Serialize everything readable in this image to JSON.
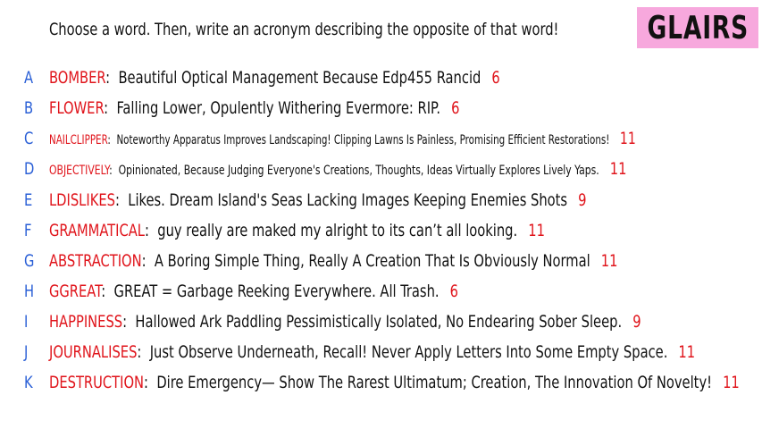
{
  "prompt": "Choose a word. Then, write an acronym describing the opposite of that word!",
  "logo": {
    "text": "GLAIRS",
    "background": "#f7a8dd"
  },
  "colors": {
    "letter": "#2a5fd6",
    "word": "#e0141b",
    "count": "#e0141b",
    "text": "#111111"
  },
  "entries": [
    {
      "letter": "A",
      "word": "BOMBER",
      "sep": ":",
      "acronym": "Beautiful Optical Management Because Edp455 Rancid",
      "count": "6"
    },
    {
      "letter": "B",
      "word": "FLOWER",
      "sep": ":",
      "acronym": "Falling Lower, Opulently Withering Evermore: RIP.",
      "count": "6"
    },
    {
      "letter": "C",
      "word": "NAILCLIPPER",
      "sep": ":",
      "acronym": "Noteworthy Apparatus Improves Landscaping! Clipping Lawns Is Painless, Promising Efficient Restorations!",
      "count": "11"
    },
    {
      "letter": "D",
      "word": "OBJECTIVELY",
      "sep": ":",
      "acronym": "Opinionated, Because Judging Everyone's Creations, Thoughts, Ideas Virtually Explores Lively Yaps.",
      "count": "11"
    },
    {
      "letter": "E",
      "word": "LDISLIKES",
      "sep": ":",
      "acronym": "Likes. Dream Island's Seas Lacking Images Keeping Enemies Shots",
      "count": "9"
    },
    {
      "letter": "F",
      "word": "GRAMMATICAL",
      "sep": ":",
      "acronym": "guy really are maked my alright to its can’t all looking.",
      "count": "11"
    },
    {
      "letter": "G",
      "word": "ABSTRACTION",
      "sep": ":",
      "acronym": "A Boring Simple Thing, Really A Creation That Is Obviously Normal",
      "count": "11"
    },
    {
      "letter": "H",
      "word": "GGREAT",
      "sep": ":",
      "acronym": "GREAT = Garbage Reeking Everywhere. All Trash.",
      "count": "6"
    },
    {
      "letter": "I",
      "word": "HAPPINESS",
      "sep": ":",
      "acronym": "Hallowed Ark Paddling Pessimistically Isolated, No Endearing Sober Sleep.",
      "count": "9"
    },
    {
      "letter": "J",
      "word": "JOURNALISES",
      "sep": ":",
      "acronym": "Just Observe Underneath, Recall! Never Apply Letters Into Some Empty Space.",
      "count": "11"
    },
    {
      "letter": "K",
      "word": "DESTRUCTION",
      "sep": ":",
      "acronym": "Dire Emergency— Show The Rarest Ultimatum; Creation, The Innovation Of Novelty!",
      "count": "11"
    }
  ]
}
